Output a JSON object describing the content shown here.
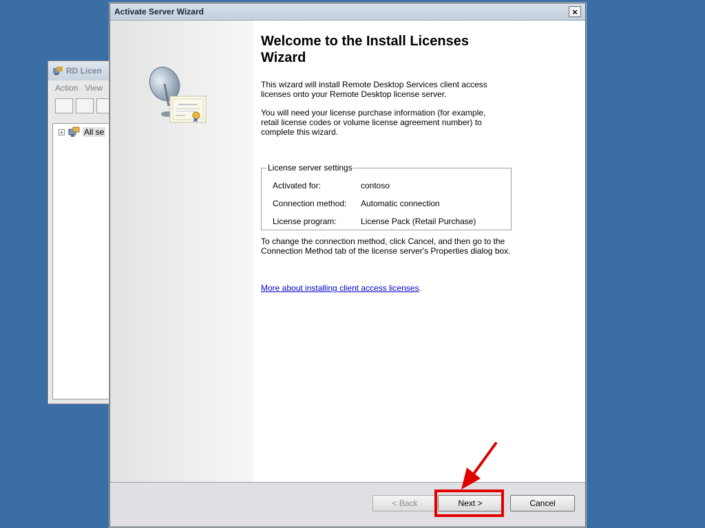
{
  "background_window": {
    "title": "RD Licen",
    "menu": [
      "Action",
      "View"
    ],
    "tree_item": "All se"
  },
  "wizard": {
    "title": "Activate Server Wizard",
    "close_glyph": "×",
    "heading": "Welcome to the Install Licenses Wizard",
    "intro": "This wizard will install Remote Desktop Services client access licenses onto your Remote Desktop license server.",
    "requirements": "You will need your license purchase information (for example, retail license codes or volume license agreement number) to complete this wizard.",
    "settings": {
      "legend": "License server settings",
      "rows": [
        {
          "label": "Activated for:",
          "value": "contoso"
        },
        {
          "label": "Connection method:",
          "value": "Automatic connection"
        },
        {
          "label": "License program:",
          "value": "License Pack (Retail Purchase)"
        }
      ]
    },
    "change_instructions": "To change the connection method, click Cancel, and then go to the Connection Method tab of the license server's Properties dialog box.",
    "more_link": "More about installing client access licenses",
    "more_link_suffix": ".",
    "buttons": {
      "back": "< Back",
      "next": "Next >",
      "cancel": "Cancel"
    }
  },
  "annotation": {
    "highlight_color": "#e00000",
    "target": "Next >"
  }
}
